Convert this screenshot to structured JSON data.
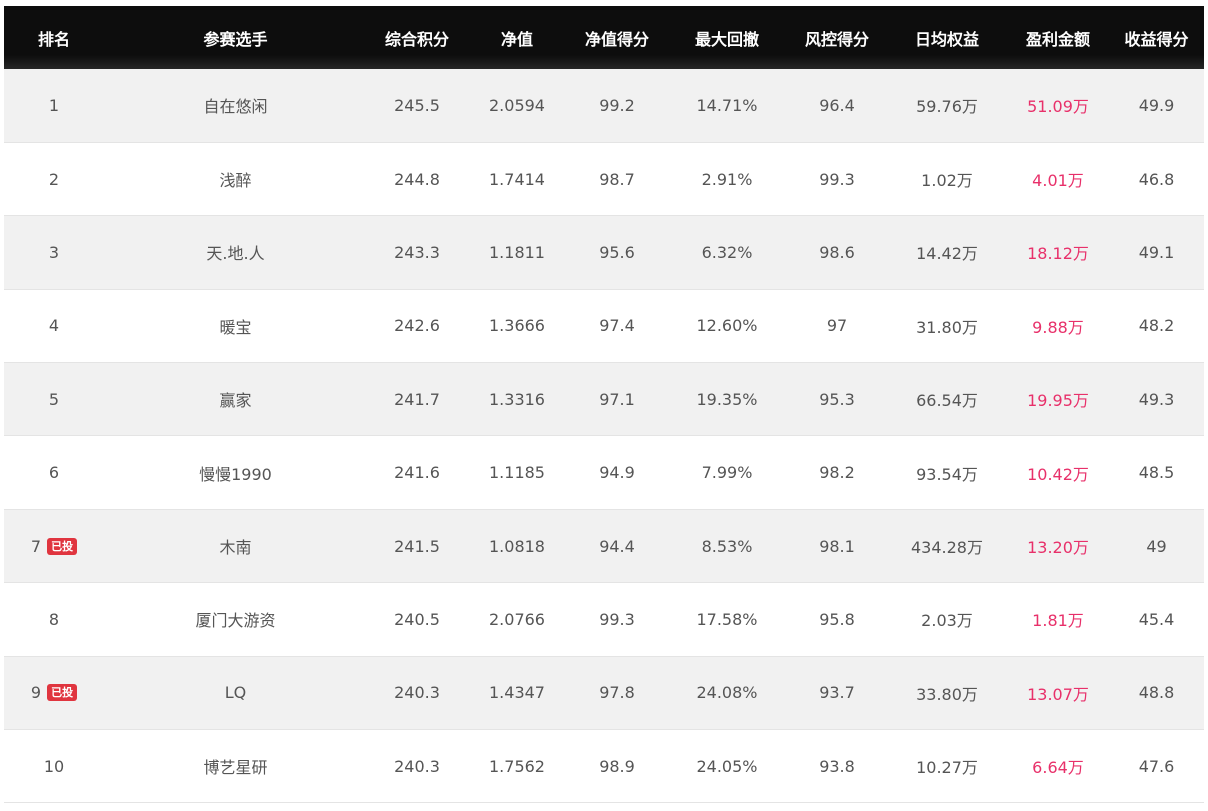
{
  "headers": {
    "rank": "排名",
    "player": "参赛选手",
    "total": "综合积分",
    "nav": "净值",
    "nav_score": "净值得分",
    "max_drawdown": "最大回撤",
    "risk_score": "风控得分",
    "daily_equity": "日均权益",
    "profit": "盈利金额",
    "return_score": "收益得分"
  },
  "badge_text": "已投",
  "colors": {
    "header_bg": "#0d0d0d",
    "odd_row_bg": "#f1f1f1",
    "even_row_bg": "#ffffff",
    "profit_text": "#e8306a",
    "badge_bg": "#e0353f",
    "body_text": "#555555"
  },
  "rows": [
    {
      "rank": "1",
      "invested": false,
      "player": "自在悠闲",
      "total": "245.5",
      "nav": "2.0594",
      "nav_score": "99.2",
      "max_drawdown": "14.71%",
      "risk_score": "96.4",
      "daily_equity": "59.76万",
      "profit": "51.09万",
      "return_score": "49.9"
    },
    {
      "rank": "2",
      "invested": false,
      "player": "浅醉",
      "total": "244.8",
      "nav": "1.7414",
      "nav_score": "98.7",
      "max_drawdown": "2.91%",
      "risk_score": "99.3",
      "daily_equity": "1.02万",
      "profit": "4.01万",
      "return_score": "46.8"
    },
    {
      "rank": "3",
      "invested": false,
      "player": "天.地.人",
      "total": "243.3",
      "nav": "1.1811",
      "nav_score": "95.6",
      "max_drawdown": "6.32%",
      "risk_score": "98.6",
      "daily_equity": "14.42万",
      "profit": "18.12万",
      "return_score": "49.1"
    },
    {
      "rank": "4",
      "invested": false,
      "player": "暖宝",
      "total": "242.6",
      "nav": "1.3666",
      "nav_score": "97.4",
      "max_drawdown": "12.60%",
      "risk_score": "97",
      "daily_equity": "31.80万",
      "profit": "9.88万",
      "return_score": "48.2"
    },
    {
      "rank": "5",
      "invested": false,
      "player": "赢家",
      "total": "241.7",
      "nav": "1.3316",
      "nav_score": "97.1",
      "max_drawdown": "19.35%",
      "risk_score": "95.3",
      "daily_equity": "66.54万",
      "profit": "19.95万",
      "return_score": "49.3"
    },
    {
      "rank": "6",
      "invested": false,
      "player": "慢慢1990",
      "total": "241.6",
      "nav": "1.1185",
      "nav_score": "94.9",
      "max_drawdown": "7.99%",
      "risk_score": "98.2",
      "daily_equity": "93.54万",
      "profit": "10.42万",
      "return_score": "48.5"
    },
    {
      "rank": "7",
      "invested": true,
      "player": "木南",
      "total": "241.5",
      "nav": "1.0818",
      "nav_score": "94.4",
      "max_drawdown": "8.53%",
      "risk_score": "98.1",
      "daily_equity": "434.28万",
      "profit": "13.20万",
      "return_score": "49"
    },
    {
      "rank": "8",
      "invested": false,
      "player": "厦门大游资",
      "total": "240.5",
      "nav": "2.0766",
      "nav_score": "99.3",
      "max_drawdown": "17.58%",
      "risk_score": "95.8",
      "daily_equity": "2.03万",
      "profit": "1.81万",
      "return_score": "45.4"
    },
    {
      "rank": "9",
      "invested": true,
      "player": "LQ",
      "total": "240.3",
      "nav": "1.4347",
      "nav_score": "97.8",
      "max_drawdown": "24.08%",
      "risk_score": "93.7",
      "daily_equity": "33.80万",
      "profit": "13.07万",
      "return_score": "48.8"
    },
    {
      "rank": "10",
      "invested": false,
      "player": "博艺星研",
      "total": "240.3",
      "nav": "1.7562",
      "nav_score": "98.9",
      "max_drawdown": "24.05%",
      "risk_score": "93.8",
      "daily_equity": "10.27万",
      "profit": "6.64万",
      "return_score": "47.6"
    }
  ]
}
